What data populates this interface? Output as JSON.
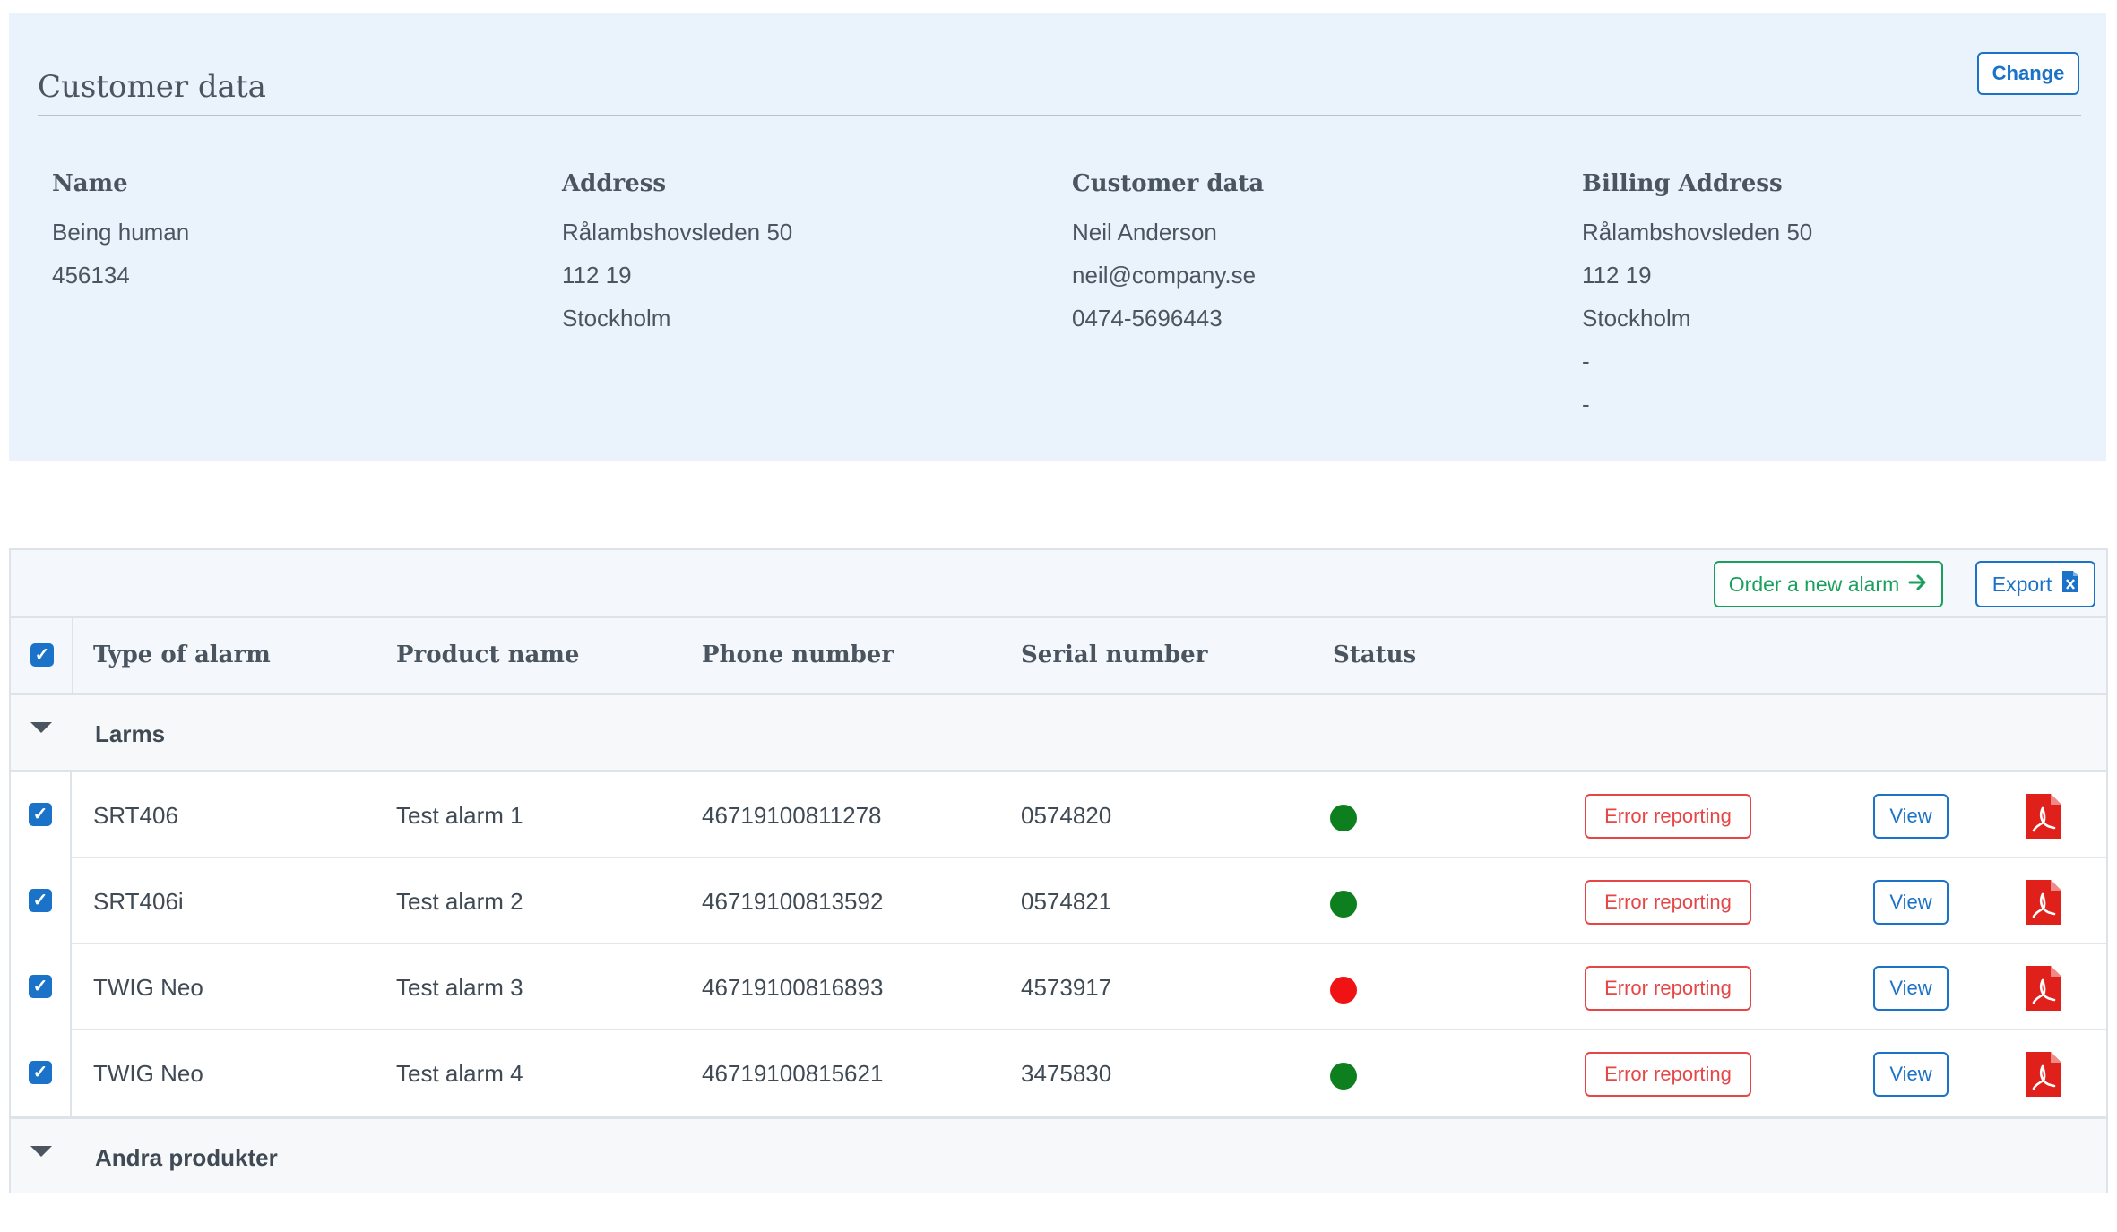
{
  "customer_panel": {
    "title": "Customer data",
    "change_label": "Change",
    "columns": [
      {
        "heading": "Name",
        "lines": [
          "Being human",
          "456134"
        ]
      },
      {
        "heading": "Address",
        "lines": [
          "Rålambshovsleden 50",
          "112 19",
          "Stockholm"
        ]
      },
      {
        "heading": "Customer data",
        "lines": [
          "Neil Anderson",
          "neil@company.se",
          "0474-5696443"
        ]
      },
      {
        "heading": "Billing Address",
        "lines": [
          "Rålambshovsleden 50",
          "112 19",
          "Stockholm",
          "-",
          "-"
        ]
      }
    ]
  },
  "toolbar": {
    "order_label": "Order a new alarm",
    "export_label": "Export"
  },
  "table": {
    "headers": [
      "Type of alarm",
      "Product name",
      "Phone number",
      "Serial number",
      "Status"
    ],
    "groups": [
      {
        "label": "Larms",
        "rows": [
          {
            "type": "SRT406",
            "product": "Test alarm 1",
            "phone": "46719100811278",
            "serial": "0574820",
            "status": "ok",
            "status_color": "#0e7f1e"
          },
          {
            "type": "SRT406i",
            "product": "Test alarm 2",
            "phone": "46719100813592",
            "serial": "0574821",
            "status": "ok",
            "status_color": "#0e7f1e"
          },
          {
            "type": "TWIG Neo",
            "product": "Test alarm 3",
            "phone": "46719100816893",
            "serial": "4573917",
            "status": "error",
            "status_color": "#ef1313"
          },
          {
            "type": "TWIG Neo",
            "product": "Test alarm 4",
            "phone": "46719100815621",
            "serial": "3475830",
            "status": "ok",
            "status_color": "#0e7f1e"
          }
        ]
      },
      {
        "label": "Andra produkter",
        "rows": []
      }
    ],
    "row_actions": {
      "error_label": "Error reporting",
      "view_label": "View"
    }
  },
  "icons": {
    "order_arrow": "arrow-right-icon",
    "export": "excel-file-icon",
    "pdf": "pdf-file-icon",
    "group_toggle": "caret-down-icon",
    "checkbox": "checkmark-icon"
  }
}
